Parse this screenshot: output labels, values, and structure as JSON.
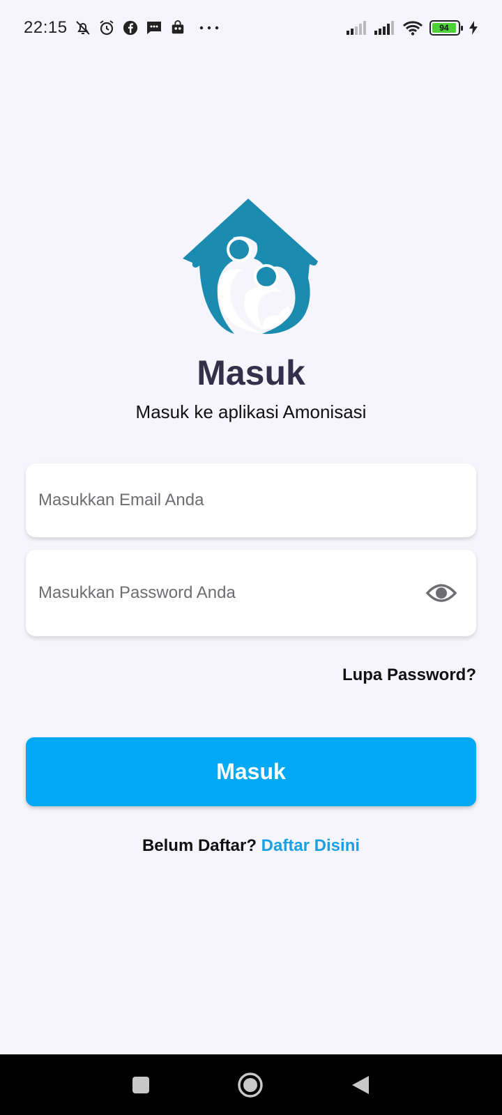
{
  "status_bar": {
    "time": "22:15",
    "battery_level": "94",
    "icons_left": [
      "notifications-off-icon",
      "alarm-icon",
      "facebook-icon",
      "message-icon",
      "shopping-bag-icon",
      "more-dots-icon"
    ],
    "icons_right": [
      "signal-icon",
      "signal-icon",
      "wifi-icon",
      "battery-icon",
      "charging-icon"
    ]
  },
  "login": {
    "logo": "home-family-logo",
    "title": "Masuk",
    "subtitle": "Masuk ke aplikasi Amonisasi",
    "email_placeholder": "Masukkan Email Anda",
    "password_placeholder": "Masukkan Password Anda",
    "forgot_password": "Lupa Password?",
    "submit_label": "Masuk",
    "register_prefix": "Belum Daftar?",
    "register_link": "Daftar Disini"
  },
  "colors": {
    "background": "#f5f5fb",
    "primary": "#03a9f4",
    "logo": "#1b8cb0",
    "title": "#34304a",
    "link": "#1ba0e0"
  },
  "nav_bar": {
    "buttons": [
      "recent-apps-icon",
      "home-icon",
      "back-icon"
    ]
  }
}
